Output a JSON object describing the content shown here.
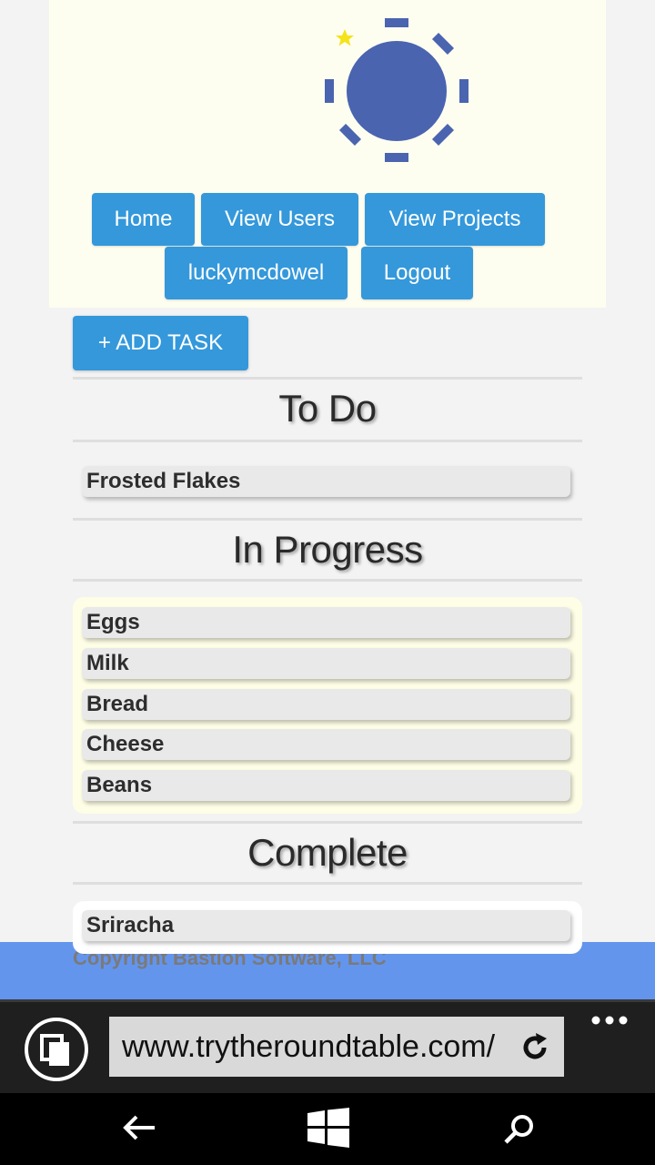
{
  "nav": {
    "home": "Home",
    "view_users": "View Users",
    "view_projects": "View Projects",
    "username": "luckymcdowel",
    "logout": "Logout"
  },
  "add_task_label": "+ ADD TASK",
  "sections": {
    "todo": {
      "title": "To Do",
      "items": [
        "Frosted Flakes"
      ]
    },
    "in_progress": {
      "title": "In Progress",
      "items": [
        "Eggs",
        "Milk",
        "Bread",
        "Cheese",
        "Beans"
      ]
    },
    "complete": {
      "title": "Complete",
      "items": [
        "Sriracha"
      ]
    }
  },
  "footer": {
    "copyright": "Copyright Bastion Software, LLC"
  },
  "browser": {
    "url": "www.trytheroundtable.com/"
  },
  "colors": {
    "button_blue": "#3498db",
    "header_bg": "#fefef0",
    "footer_blue": "#6495ed",
    "logo_blue": "#4a64b0",
    "star_yellow": "#f5e31a"
  },
  "icons": {
    "logo": "round-table-logo",
    "tabs": "tabs-icon",
    "refresh": "refresh-icon",
    "more": "more-dots-icon",
    "back": "back-arrow-icon",
    "start": "windows-start-icon",
    "search": "search-icon"
  }
}
